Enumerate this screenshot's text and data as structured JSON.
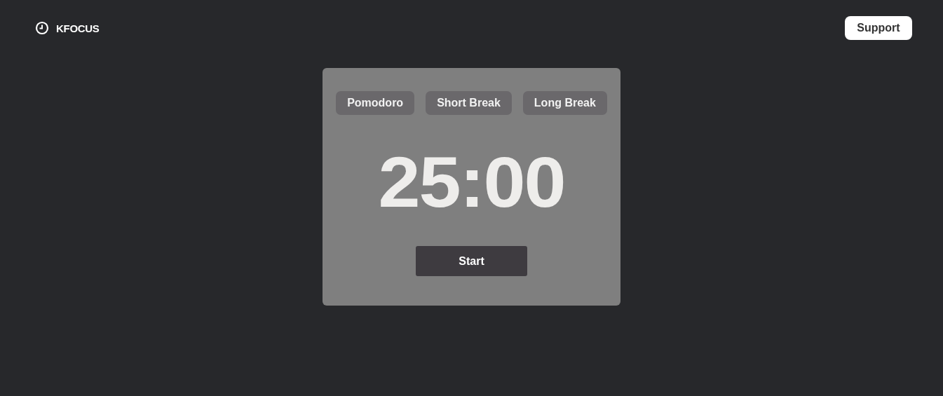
{
  "brand": {
    "name": "KFOCUS"
  },
  "support_button": {
    "label": "Support"
  },
  "tabs": [
    {
      "label": "Pomodoro"
    },
    {
      "label": "Short Break"
    },
    {
      "label": "Long Break"
    }
  ],
  "timer": {
    "time": "25:00"
  },
  "start_button": {
    "label": "Start"
  }
}
